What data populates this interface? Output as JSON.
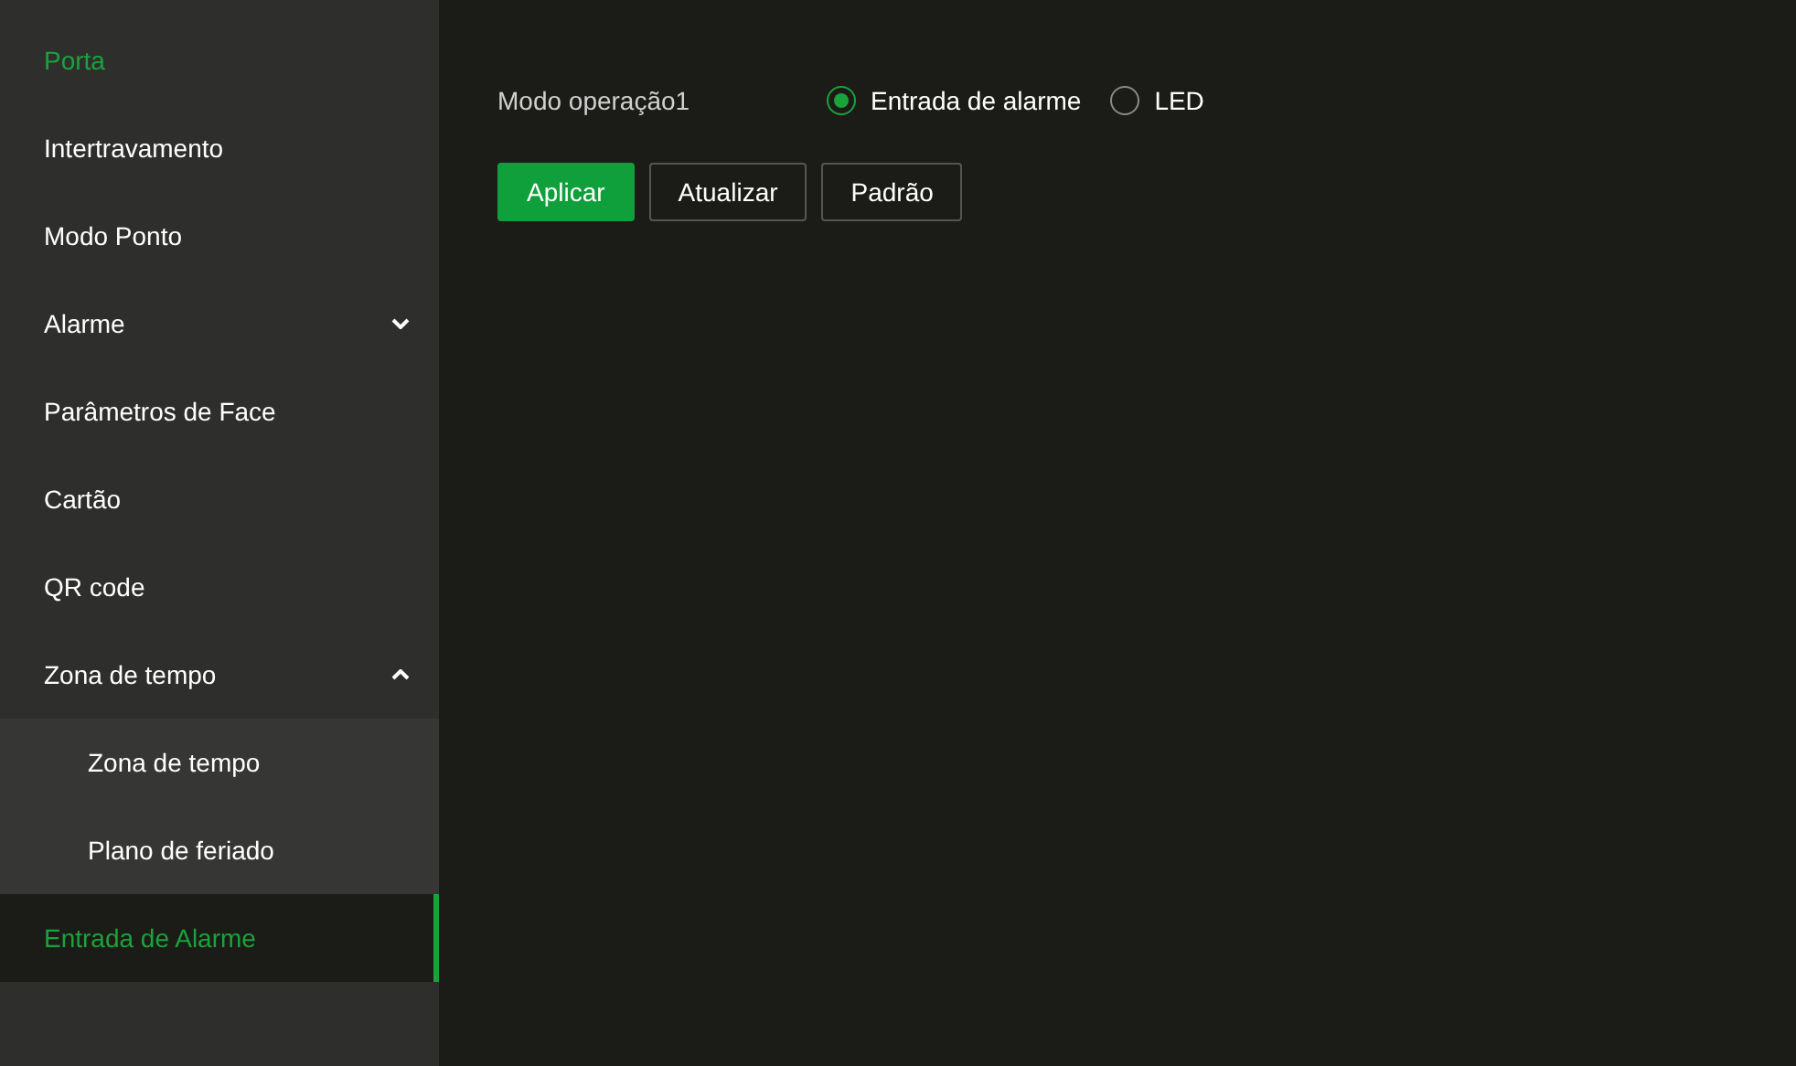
{
  "sidebar": {
    "items": [
      {
        "label": "Porta",
        "kind": "heading",
        "selected": false
      },
      {
        "label": "Intertravamento",
        "kind": "link",
        "selected": false
      },
      {
        "label": "Modo Ponto",
        "kind": "link",
        "selected": false
      },
      {
        "label": "Alarme",
        "kind": "group",
        "selected": false,
        "expanded": false
      },
      {
        "label": "Parâmetros de Face",
        "kind": "link",
        "selected": false
      },
      {
        "label": "Cartão",
        "kind": "link",
        "selected": false
      },
      {
        "label": "QR code",
        "kind": "link",
        "selected": false
      },
      {
        "label": "Zona de tempo",
        "kind": "group",
        "selected": false,
        "expanded": true,
        "children": [
          {
            "label": "Zona de tempo",
            "selected": false
          },
          {
            "label": "Plano de feriado",
            "selected": false
          }
        ]
      },
      {
        "label": "Entrada de Alarme",
        "kind": "link",
        "selected": true
      }
    ]
  },
  "form": {
    "label": "Modo operação1",
    "options": [
      {
        "label": "Entrada de alarme",
        "selected": true
      },
      {
        "label": "LED",
        "selected": false
      }
    ]
  },
  "buttons": [
    {
      "label": "Aplicar",
      "kind": "primary"
    },
    {
      "label": "Atualizar",
      "kind": "secondary"
    },
    {
      "label": "Padrão",
      "kind": "secondary"
    }
  ]
}
